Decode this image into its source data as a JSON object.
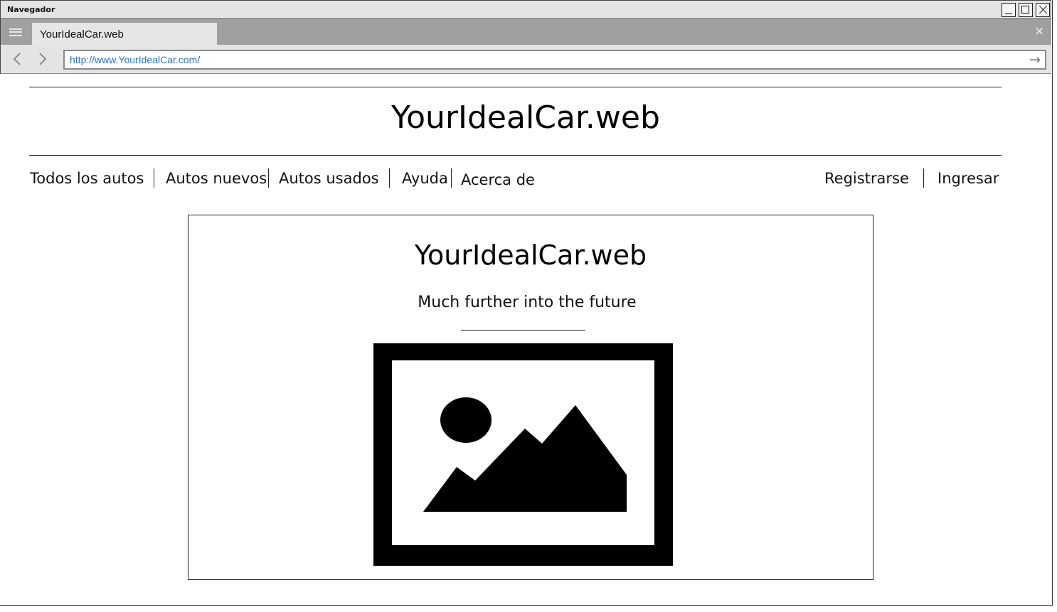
{
  "window": {
    "title": "Navegador"
  },
  "browser": {
    "tab_title": "YourIdealCar.web",
    "tab_close": "×",
    "url": "http://www.YourIdealCar.com/",
    "back": "‹",
    "forward": "›",
    "go": "→"
  },
  "page": {
    "site_title": "YourIdealCar.web",
    "nav": {
      "items": [
        {
          "label": "Todos los autos"
        },
        {
          "label": "Autos nuevos"
        },
        {
          "label": "Autos usados"
        },
        {
          "label": "Ayuda"
        },
        {
          "label": "Acerca de"
        }
      ],
      "right": [
        {
          "label": "Registrarse"
        },
        {
          "label": "Ingresar"
        }
      ]
    },
    "hero": {
      "title": "YourIdealCar.web",
      "subtitle": "Much further into the future",
      "image_icon": "image-placeholder-icon"
    }
  }
}
